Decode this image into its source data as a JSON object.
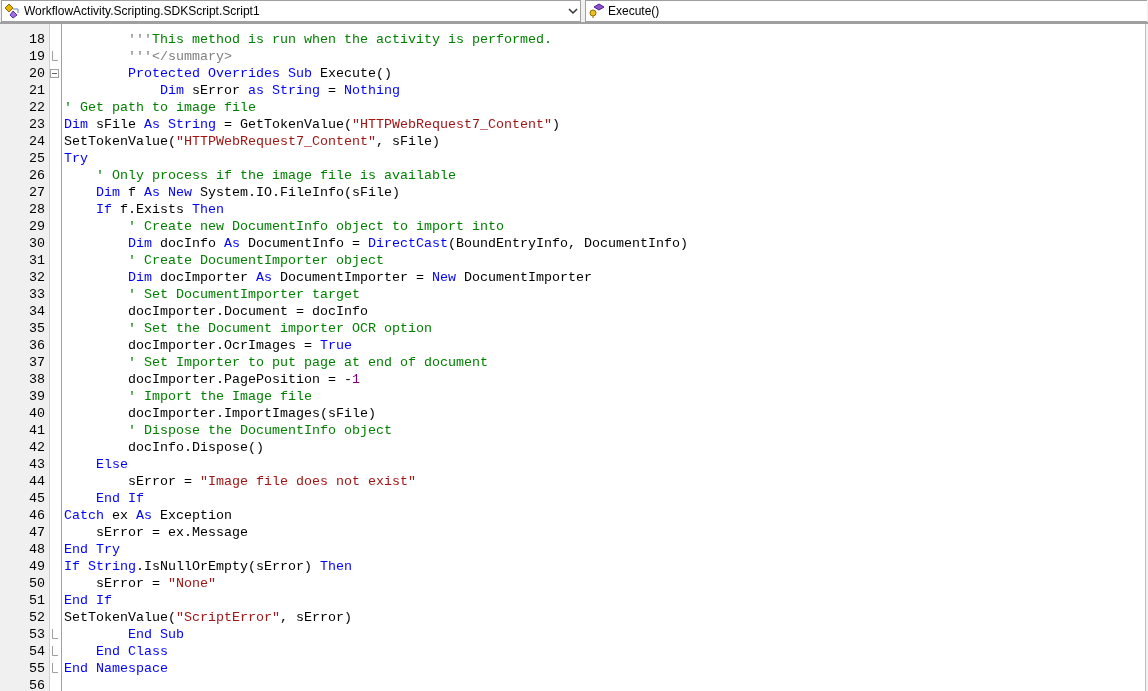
{
  "class_dropdown": {
    "value": "WorkflowActivity.Scripting.SDKScript.Script1"
  },
  "member_dropdown": {
    "value": "Execute()"
  },
  "editor": {
    "lines": [
      {
        "number": "18",
        "fold_end": false,
        "collapsible": false,
        "tokens": [
          {
            "kind": "doc",
            "text": "        '''"
          },
          {
            "kind": "comment",
            "text": "This method is run when the activity is performed."
          }
        ]
      },
      {
        "number": "19",
        "fold_end": true,
        "collapsible": false,
        "tokens": [
          {
            "kind": "doc",
            "text": "        '''</summary>"
          }
        ]
      },
      {
        "number": "20",
        "fold_end": false,
        "collapsible": true,
        "tokens": [
          {
            "kind": "keyword",
            "text": "        Protected Overrides Sub"
          },
          {
            "kind": "plain",
            "text": " Execute()"
          }
        ]
      },
      {
        "number": "21",
        "fold_end": false,
        "collapsible": false,
        "tokens": [
          {
            "kind": "keyword",
            "text": "            Dim"
          },
          {
            "kind": "plain",
            "text": " sError "
          },
          {
            "kind": "keyword",
            "text": "as String"
          },
          {
            "kind": "plain",
            "text": " = "
          },
          {
            "kind": "keyword",
            "text": "Nothing"
          }
        ]
      },
      {
        "number": "22",
        "fold_end": false,
        "collapsible": false,
        "tokens": [
          {
            "kind": "comment",
            "text": "' Get path to image file"
          }
        ]
      },
      {
        "number": "23",
        "fold_end": false,
        "collapsible": false,
        "tokens": [
          {
            "kind": "keyword",
            "text": "Dim"
          },
          {
            "kind": "plain",
            "text": " sFile "
          },
          {
            "kind": "keyword",
            "text": "As String"
          },
          {
            "kind": "plain",
            "text": " = GetTokenValue("
          },
          {
            "kind": "string",
            "text": "\"HTTPWebRequest7_Content\""
          },
          {
            "kind": "plain",
            "text": ")"
          }
        ]
      },
      {
        "number": "24",
        "fold_end": false,
        "collapsible": false,
        "tokens": [
          {
            "kind": "plain",
            "text": "SetTokenValue("
          },
          {
            "kind": "string",
            "text": "\"HTTPWebRequest7_Content\""
          },
          {
            "kind": "plain",
            "text": ", sFile)"
          }
        ]
      },
      {
        "number": "25",
        "fold_end": false,
        "collapsible": false,
        "tokens": [
          {
            "kind": "keyword",
            "text": "Try"
          }
        ]
      },
      {
        "number": "26",
        "fold_end": false,
        "collapsible": false,
        "tokens": [
          {
            "kind": "comment",
            "text": "    ' Only process if the image file is available"
          }
        ]
      },
      {
        "number": "27",
        "fold_end": false,
        "collapsible": false,
        "tokens": [
          {
            "kind": "keyword",
            "text": "    Dim"
          },
          {
            "kind": "plain",
            "text": " f "
          },
          {
            "kind": "keyword",
            "text": "As New"
          },
          {
            "kind": "plain",
            "text": " System.IO.FileInfo(sFile)"
          }
        ]
      },
      {
        "number": "28",
        "fold_end": false,
        "collapsible": false,
        "tokens": [
          {
            "kind": "keyword",
            "text": "    If"
          },
          {
            "kind": "plain",
            "text": " f.Exists "
          },
          {
            "kind": "keyword",
            "text": "Then"
          }
        ]
      },
      {
        "number": "29",
        "fold_end": false,
        "collapsible": false,
        "tokens": [
          {
            "kind": "comment",
            "text": "        ' Create new DocumentInfo object to import into"
          }
        ]
      },
      {
        "number": "30",
        "fold_end": false,
        "collapsible": false,
        "tokens": [
          {
            "kind": "keyword",
            "text": "        Dim"
          },
          {
            "kind": "plain",
            "text": " docInfo "
          },
          {
            "kind": "keyword",
            "text": "As"
          },
          {
            "kind": "plain",
            "text": " DocumentInfo = "
          },
          {
            "kind": "keyword",
            "text": "DirectCast"
          },
          {
            "kind": "plain",
            "text": "(BoundEntryInfo, DocumentInfo)"
          }
        ]
      },
      {
        "number": "31",
        "fold_end": false,
        "collapsible": false,
        "tokens": [
          {
            "kind": "comment",
            "text": "        ' Create DocumentImporter object"
          }
        ]
      },
      {
        "number": "32",
        "fold_end": false,
        "collapsible": false,
        "tokens": [
          {
            "kind": "keyword",
            "text": "        Dim"
          },
          {
            "kind": "plain",
            "text": " docImporter "
          },
          {
            "kind": "keyword",
            "text": "As"
          },
          {
            "kind": "plain",
            "text": " DocumentImporter = "
          },
          {
            "kind": "keyword",
            "text": "New"
          },
          {
            "kind": "plain",
            "text": " DocumentImporter"
          }
        ]
      },
      {
        "number": "33",
        "fold_end": false,
        "collapsible": false,
        "tokens": [
          {
            "kind": "comment",
            "text": "        ' Set DocumentImporter target"
          }
        ]
      },
      {
        "number": "34",
        "fold_end": false,
        "collapsible": false,
        "tokens": [
          {
            "kind": "plain",
            "text": "        docImporter.Document = docInfo"
          }
        ]
      },
      {
        "number": "35",
        "fold_end": false,
        "collapsible": false,
        "tokens": [
          {
            "kind": "comment",
            "text": "        ' Set the Document importer OCR option"
          }
        ]
      },
      {
        "number": "36",
        "fold_end": false,
        "collapsible": false,
        "tokens": [
          {
            "kind": "plain",
            "text": "        docImporter.OcrImages = "
          },
          {
            "kind": "keyword",
            "text": "True"
          }
        ]
      },
      {
        "number": "37",
        "fold_end": false,
        "collapsible": false,
        "tokens": [
          {
            "kind": "comment",
            "text": "        ' Set Importer to put page at end of document"
          }
        ]
      },
      {
        "number": "38",
        "fold_end": false,
        "collapsible": false,
        "tokens": [
          {
            "kind": "plain",
            "text": "        docImporter.PagePosition = -"
          },
          {
            "kind": "number",
            "text": "1"
          }
        ]
      },
      {
        "number": "39",
        "fold_end": false,
        "collapsible": false,
        "tokens": [
          {
            "kind": "comment",
            "text": "        ' Import the Image file"
          }
        ]
      },
      {
        "number": "40",
        "fold_end": false,
        "collapsible": false,
        "tokens": [
          {
            "kind": "plain",
            "text": "        docImporter.ImportImages(sFile)"
          }
        ]
      },
      {
        "number": "41",
        "fold_end": false,
        "collapsible": false,
        "tokens": [
          {
            "kind": "comment",
            "text": "        ' Dispose the DocumentInfo object"
          }
        ]
      },
      {
        "number": "42",
        "fold_end": false,
        "collapsible": false,
        "tokens": [
          {
            "kind": "plain",
            "text": "        docInfo.Dispose()"
          }
        ]
      },
      {
        "number": "43",
        "fold_end": false,
        "collapsible": false,
        "tokens": [
          {
            "kind": "keyword",
            "text": "    Else"
          }
        ]
      },
      {
        "number": "44",
        "fold_end": false,
        "collapsible": false,
        "tokens": [
          {
            "kind": "plain",
            "text": "        sError = "
          },
          {
            "kind": "string",
            "text": "\"Image file does not exist\""
          }
        ]
      },
      {
        "number": "45",
        "fold_end": false,
        "collapsible": false,
        "tokens": [
          {
            "kind": "keyword",
            "text": "    End If"
          }
        ]
      },
      {
        "number": "46",
        "fold_end": false,
        "collapsible": false,
        "tokens": [
          {
            "kind": "keyword",
            "text": "Catch"
          },
          {
            "kind": "plain",
            "text": " ex "
          },
          {
            "kind": "keyword",
            "text": "As"
          },
          {
            "kind": "plain",
            "text": " Exception"
          }
        ]
      },
      {
        "number": "47",
        "fold_end": false,
        "collapsible": false,
        "tokens": [
          {
            "kind": "plain",
            "text": "    sError = ex.Message"
          }
        ]
      },
      {
        "number": "48",
        "fold_end": false,
        "collapsible": false,
        "tokens": [
          {
            "kind": "keyword",
            "text": "End Try"
          }
        ]
      },
      {
        "number": "49",
        "fold_end": false,
        "collapsible": false,
        "tokens": [
          {
            "kind": "keyword",
            "text": "If String"
          },
          {
            "kind": "plain",
            "text": ".IsNullOrEmpty(sError) "
          },
          {
            "kind": "keyword",
            "text": "Then"
          }
        ]
      },
      {
        "number": "50",
        "fold_end": false,
        "collapsible": false,
        "tokens": [
          {
            "kind": "plain",
            "text": "    sError = "
          },
          {
            "kind": "string",
            "text": "\"None\""
          }
        ]
      },
      {
        "number": "51",
        "fold_end": false,
        "collapsible": false,
        "tokens": [
          {
            "kind": "keyword",
            "text": "End If"
          }
        ]
      },
      {
        "number": "52",
        "fold_end": false,
        "collapsible": false,
        "tokens": [
          {
            "kind": "plain",
            "text": "SetTokenValue("
          },
          {
            "kind": "string",
            "text": "\"ScriptError\""
          },
          {
            "kind": "plain",
            "text": ", sError)"
          }
        ]
      },
      {
        "number": "53",
        "fold_end": true,
        "collapsible": false,
        "tokens": [
          {
            "kind": "keyword",
            "text": "        End Sub"
          }
        ]
      },
      {
        "number": "54",
        "fold_end": true,
        "collapsible": false,
        "tokens": [
          {
            "kind": "keyword",
            "text": "    End Class"
          }
        ]
      },
      {
        "number": "55",
        "fold_end": true,
        "collapsible": false,
        "tokens": [
          {
            "kind": "keyword",
            "text": "End Namespace"
          }
        ]
      },
      {
        "number": "56",
        "fold_end": false,
        "collapsible": false
      }
    ]
  }
}
